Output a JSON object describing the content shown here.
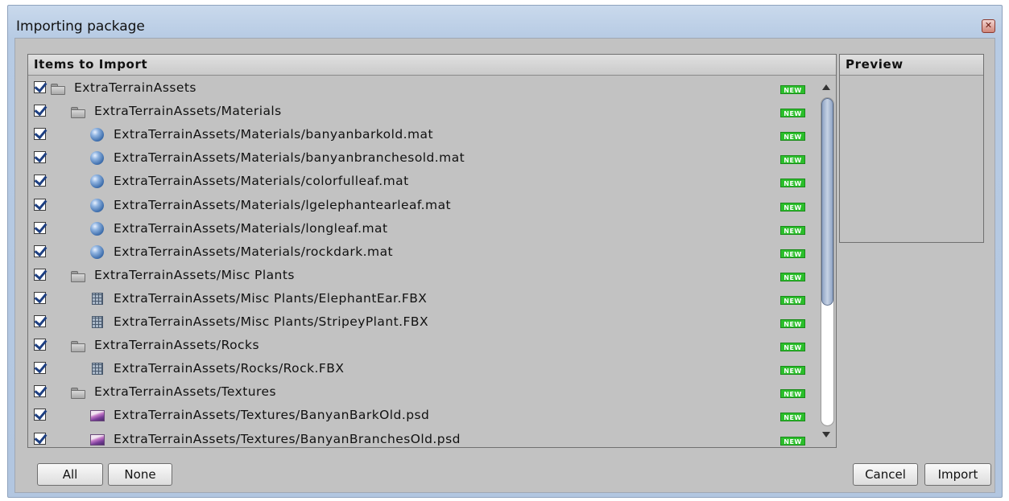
{
  "window": {
    "title": "Importing package",
    "close_icon": "close-icon"
  },
  "items_panel": {
    "header": "Items to Import"
  },
  "preview_panel": {
    "header": "Preview"
  },
  "new_badge": "NEW",
  "items": [
    {
      "label": "ExtraTerrainAssets",
      "icon": "folder-icon",
      "level": 0,
      "checked": true,
      "status": "NEW"
    },
    {
      "label": "ExtraTerrainAssets/Materials",
      "icon": "folder-icon",
      "level": 1,
      "checked": true,
      "status": "NEW"
    },
    {
      "label": "ExtraTerrainAssets/Materials/banyanbarkold.mat",
      "icon": "material-icon",
      "level": 2,
      "checked": true,
      "status": "NEW"
    },
    {
      "label": "ExtraTerrainAssets/Materials/banyanbranchesold.mat",
      "icon": "material-icon",
      "level": 2,
      "checked": true,
      "status": "NEW"
    },
    {
      "label": "ExtraTerrainAssets/Materials/colorfulleaf.mat",
      "icon": "material-icon",
      "level": 2,
      "checked": true,
      "status": "NEW"
    },
    {
      "label": "ExtraTerrainAssets/Materials/lgelephantearleaf.mat",
      "icon": "material-icon",
      "level": 2,
      "checked": true,
      "status": "NEW"
    },
    {
      "label": "ExtraTerrainAssets/Materials/longleaf.mat",
      "icon": "material-icon",
      "level": 2,
      "checked": true,
      "status": "NEW"
    },
    {
      "label": "ExtraTerrainAssets/Materials/rockdark.mat",
      "icon": "material-icon",
      "level": 2,
      "checked": true,
      "status": "NEW"
    },
    {
      "label": "ExtraTerrainAssets/Misc Plants",
      "icon": "folder-icon",
      "level": 1,
      "checked": true,
      "status": "NEW"
    },
    {
      "label": "ExtraTerrainAssets/Misc Plants/ElephantEar.FBX",
      "icon": "model-icon",
      "level": 2,
      "checked": true,
      "status": "NEW"
    },
    {
      "label": "ExtraTerrainAssets/Misc Plants/StripeyPlant.FBX",
      "icon": "model-icon",
      "level": 2,
      "checked": true,
      "status": "NEW"
    },
    {
      "label": "ExtraTerrainAssets/Rocks",
      "icon": "folder-icon",
      "level": 1,
      "checked": true,
      "status": "NEW"
    },
    {
      "label": "ExtraTerrainAssets/Rocks/Rock.FBX",
      "icon": "model-icon",
      "level": 2,
      "checked": true,
      "status": "NEW"
    },
    {
      "label": "ExtraTerrainAssets/Textures",
      "icon": "folder-icon",
      "level": 1,
      "checked": true,
      "status": "NEW"
    },
    {
      "label": "ExtraTerrainAssets/Textures/BanyanBarkOld.psd",
      "icon": "texture-icon",
      "level": 2,
      "checked": true,
      "status": "NEW"
    },
    {
      "label": "ExtraTerrainAssets/Textures/BanyanBranchesOld.psd",
      "icon": "texture-icon",
      "level": 2,
      "checked": true,
      "status": "NEW"
    }
  ],
  "buttons": {
    "all": "All",
    "none": "None",
    "cancel": "Cancel",
    "import": "Import"
  },
  "colors": {
    "new_badge": "#2bbf2b",
    "panel_bg": "#c2c2c2",
    "window_chrome": "#b7cbe4",
    "scroll_thumb": "#8fa3c4"
  }
}
